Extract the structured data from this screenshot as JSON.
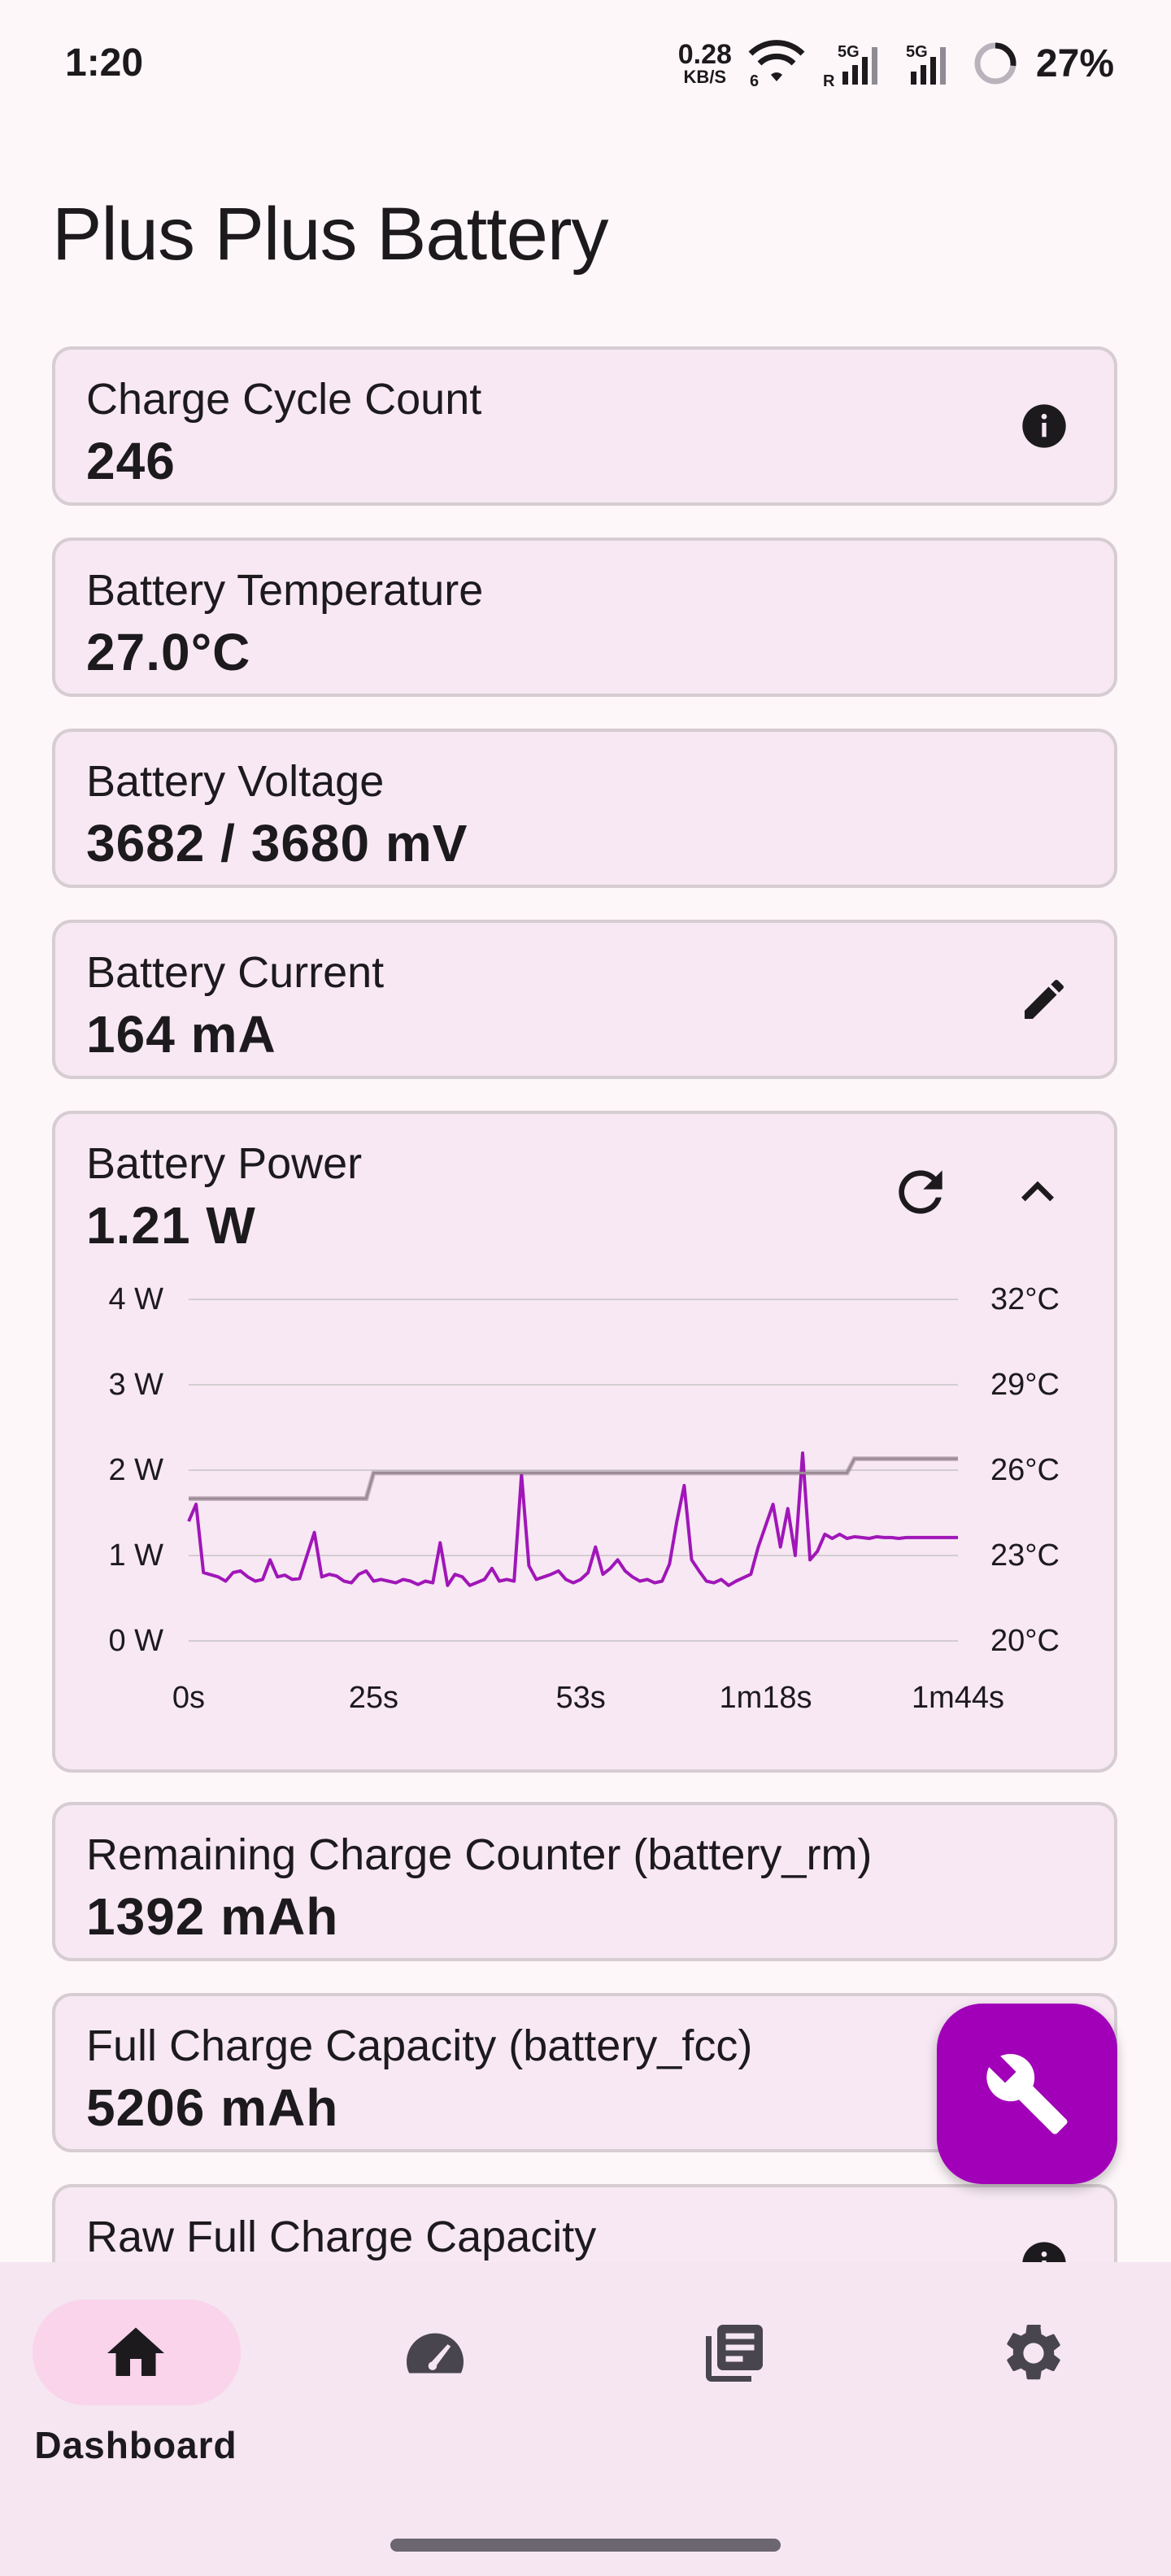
{
  "status_bar": {
    "time": "1:20",
    "net_speed_value": "0.28",
    "net_speed_unit": "KB/S",
    "wifi_label": "6",
    "signal1_label": "5G",
    "signal1_sub": "R",
    "signal2_label": "5G",
    "battery_percent": "27%",
    "battery_level": 0.27
  },
  "page": {
    "title": "Plus Plus Battery"
  },
  "cards": [
    {
      "label": "Charge Cycle Count",
      "value": "246",
      "icon": "info-icon"
    },
    {
      "label": "Battery Temperature",
      "value": "27.0°C"
    },
    {
      "label": "Battery Voltage",
      "value": "3682 / 3680 mV"
    },
    {
      "label": "Battery Current",
      "value": "164 mA",
      "icon": "edit-icon"
    }
  ],
  "power_card": {
    "label": "Battery Power",
    "value": "1.21 W",
    "refresh_icon": "refresh-icon",
    "collapse_icon": "chevron-up-icon"
  },
  "chart_data": {
    "type": "line",
    "x_tick_labels": [
      "0s",
      "25s",
      "53s",
      "1m18s",
      "1m44s"
    ],
    "x_tick_values": [
      0,
      25,
      53,
      78,
      104
    ],
    "xlim": [
      0,
      104
    ],
    "y_left_tick_labels": [
      "0 W",
      "1 W",
      "2 W",
      "3 W",
      "4 W"
    ],
    "y_left_tick_values": [
      0,
      1,
      2,
      3,
      4
    ],
    "ylim_left": [
      0,
      4
    ],
    "y_right_tick_labels": [
      "20°C",
      "23°C",
      "26°C",
      "29°C",
      "32°C"
    ],
    "y_right_tick_values": [
      20,
      23,
      26,
      29,
      32
    ],
    "ylim_right": [
      20,
      32
    ],
    "grid": true,
    "series": [
      {
        "unit": "W",
        "axis": "left",
        "color": "#a016b8",
        "x": [
          0,
          1,
          2,
          4,
          5,
          6,
          7,
          8,
          9,
          10,
          11,
          12,
          13,
          14,
          15,
          17,
          18,
          19,
          20,
          21,
          22,
          23,
          24,
          25,
          26,
          27,
          28,
          29,
          30,
          31,
          32,
          33,
          34,
          35,
          36,
          37,
          38,
          40,
          41,
          42,
          43,
          44,
          45,
          46,
          47,
          48,
          49,
          50,
          51,
          52,
          53,
          54,
          55,
          56,
          57,
          58,
          59,
          60,
          61,
          62,
          63,
          64,
          65,
          66,
          67,
          68,
          69,
          70,
          71,
          72,
          73,
          74,
          76,
          77,
          78,
          79,
          80,
          81,
          82,
          83,
          84,
          85,
          86,
          87,
          88,
          89,
          90,
          91,
          92,
          93,
          94,
          95,
          96,
          97,
          98,
          99,
          100,
          101,
          102,
          103,
          104
        ],
        "y": [
          1.4,
          1.6,
          0.8,
          0.75,
          0.7,
          0.8,
          0.82,
          0.75,
          0.7,
          0.72,
          0.95,
          0.75,
          0.77,
          0.72,
          0.73,
          1.27,
          0.75,
          0.78,
          0.76,
          0.7,
          0.68,
          0.78,
          0.82,
          0.7,
          0.72,
          0.7,
          0.68,
          0.72,
          0.7,
          0.66,
          0.7,
          0.68,
          1.15,
          0.65,
          0.78,
          0.75,
          0.65,
          0.72,
          0.85,
          0.7,
          0.72,
          0.7,
          1.95,
          0.88,
          0.72,
          0.75,
          0.78,
          0.82,
          0.72,
          0.68,
          0.72,
          0.8,
          1.1,
          0.78,
          0.85,
          0.95,
          0.82,
          0.75,
          0.7,
          0.72,
          0.68,
          0.7,
          0.9,
          1.4,
          1.82,
          0.95,
          0.82,
          0.7,
          0.68,
          0.72,
          0.65,
          0.7,
          0.78,
          1.1,
          1.35,
          1.6,
          1.1,
          1.55,
          1.0,
          2.2,
          0.95,
          1.05,
          1.25,
          1.2,
          1.25,
          1.2,
          1.22,
          1.21,
          1.2,
          1.22,
          1.21,
          1.21,
          1.2,
          1.21,
          1.21,
          1.21,
          1.21,
          1.21,
          1.21,
          1.21,
          1.21
        ]
      },
      {
        "unit": "°C",
        "axis": "right",
        "color": "#9c8a96",
        "x": [
          0,
          24,
          25,
          26,
          89,
          90,
          104
        ],
        "y": [
          25.0,
          25.0,
          25.9,
          25.9,
          25.9,
          26.4,
          26.4
        ]
      }
    ]
  },
  "cards_lower": [
    {
      "label": "Remaining Charge Counter (battery_rm)",
      "value": "1392 mAh"
    },
    {
      "label": "Full Charge Capacity (battery_fcc)",
      "value": "5206 mAh"
    },
    {
      "label": "Raw Full Charge Capacity",
      "icon": "info-icon"
    }
  ],
  "fab": {
    "icon": "wrench-icon",
    "color": "#a100b8"
  },
  "bottom_nav": [
    {
      "label": "Dashboard",
      "icon": "home-icon",
      "active": true
    },
    {
      "label": "",
      "icon": "speedometer-icon",
      "active": false
    },
    {
      "label": "",
      "icon": "library-books-icon",
      "active": false
    },
    {
      "label": "",
      "icon": "settings-gear-icon",
      "active": false
    }
  ]
}
